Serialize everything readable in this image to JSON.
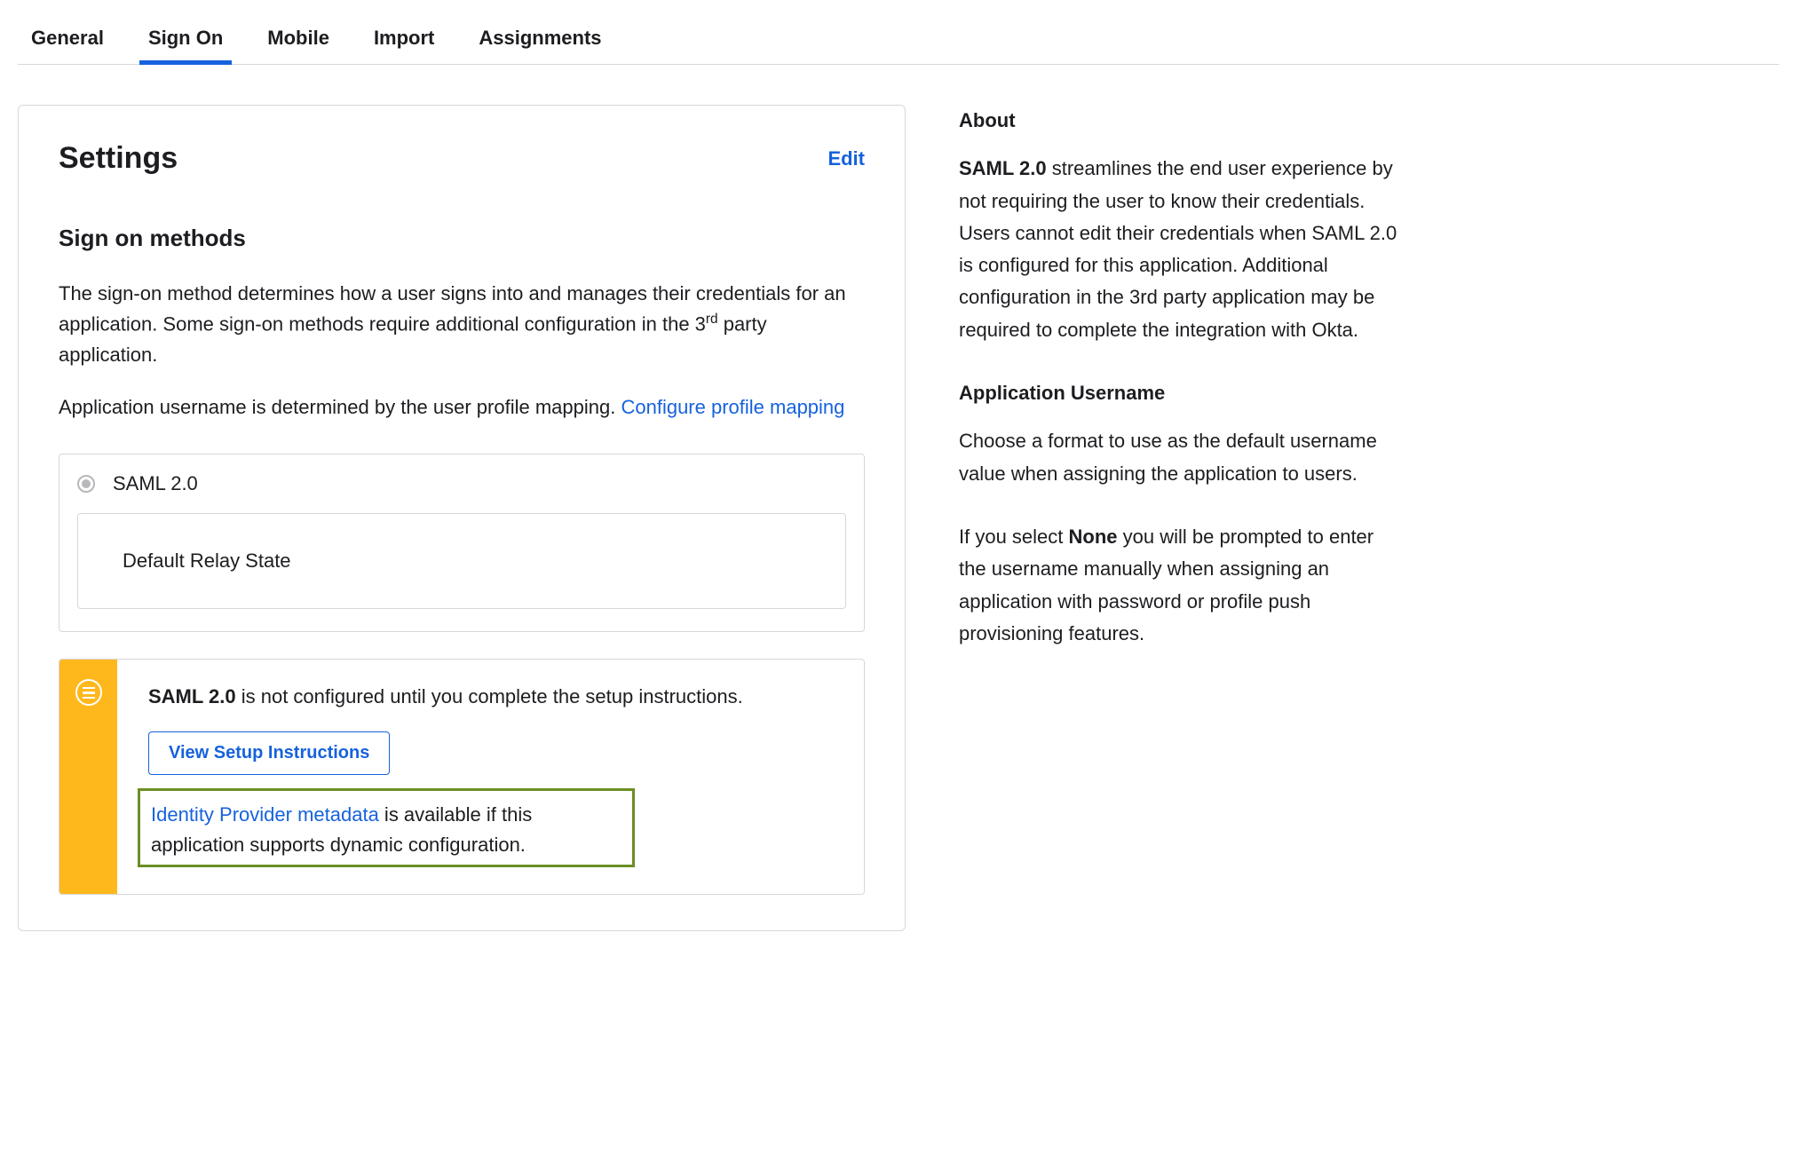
{
  "tabs": {
    "general": "General",
    "sign_on": "Sign On",
    "mobile": "Mobile",
    "import": "Import",
    "assignments": "Assignments",
    "active": "sign_on"
  },
  "settings": {
    "title": "Settings",
    "edit_label": "Edit",
    "section_title": "Sign on methods",
    "desc_part1": "The sign-on method determines how a user signs into and manages their credentials for an application. Some sign-on methods require additional configuration in the 3",
    "desc_sup": "rd",
    "desc_part2": " party application.",
    "username_text": "Application username is determined by the user profile mapping. ",
    "profile_mapping_link": "Configure profile mapping",
    "option_label": "SAML 2.0",
    "relay_label": "Default Relay State"
  },
  "notice": {
    "bold": "SAML 2.0",
    "rest": " is not configured until you complete the setup instructions.",
    "button_label": "View Setup Instructions",
    "idp_link": "Identity Provider metadata",
    "idp_rest": " is available if this application supports dynamic configuration."
  },
  "sidebar": {
    "about_heading": "About",
    "about_bold": "SAML 2.0",
    "about_rest": " streamlines the end user experience by not requiring the user to know their credentials. Users cannot edit their credentials when SAML 2.0 is configured for this application. Additional configuration in the 3rd party application may be required to complete the integration with Okta.",
    "username_heading": "Application Username",
    "username_text": "Choose a format to use as the default username value when assigning the application to users.",
    "none_pre": "If you select ",
    "none_bold": "None",
    "none_rest": " you will be prompted to enter the username manually when assigning an application with password or profile push provisioning features."
  }
}
